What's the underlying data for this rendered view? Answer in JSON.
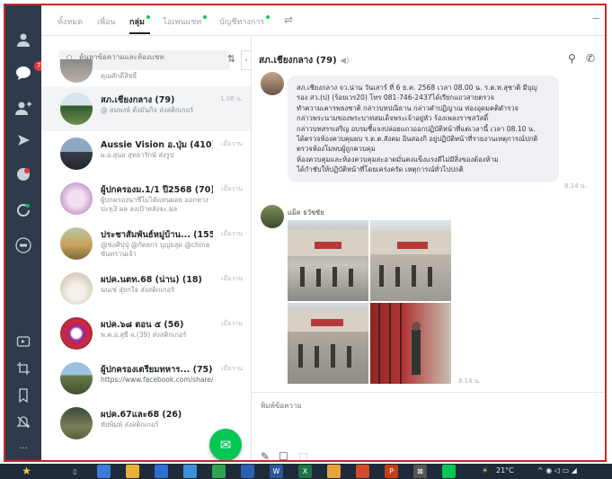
{
  "tabs": {
    "all": "ทั้งหมด",
    "friends": "เพื่อน",
    "groups": "กลุ่ม",
    "openchat": "โอเพนแชท",
    "official": "บัญชีทางการ",
    "filter_icon": "filter-icon"
  },
  "sidebar": {
    "chat_badge": "73"
  },
  "search": {
    "placeholder": "ค้นหาข้อความและห้องแชท"
  },
  "chats": [
    {
      "name": "",
      "preview": "คุณศักดิ์สิทธิ์",
      "time": ""
    },
    {
      "name": "สภ.เชียงกลาง (79)",
      "preview": "@ สมพงษ์ ตั้งมั่นกิจ ส่งสติกเกอร์",
      "time": "1.06 น."
    },
    {
      "name": "Aussie Vision อ.ปุ่ม (410)",
      "preview": "ผ.อ.สุนย สุทธารักษ์ ส่งรูป",
      "time": "เมื่อวาน"
    },
    {
      "name": "ผู้ปกครองม.1/1 ปี2568 (70)",
      "preview": "ผู้ปกครองนาซีไม่ได้แทนผลย ออกทางปะทุ3 ผล ลงเป้าหลังจะ.ผล",
      "time": "เมื่อวาน"
    },
    {
      "name": "ประชาสัมพันธ์หมู่บ้าน...",
      "count": "(155)",
      "preview": "@ช่อศิปุ่ปุ่ @กัดยกร บุญยสุด @china ขันทรานเจ้า",
      "time": "เมื่อวาน"
    },
    {
      "name": "ผปค.นตท.68 (น่าน) (18)",
      "preview": "นนเช่ สุ่ยกใจ ส่งสติกเกอร์",
      "time": "เมื่อวาน"
    },
    {
      "name": "ผปค.๖๘ ตอน ๕ (56)",
      "preview": "พ.ต.อ.สุธี จ.(39) ส่งสติกเกอร์",
      "time": "เมื่อวาน"
    },
    {
      "name": "ผู้ปกครองเตรียมทหาร...",
      "count": "(75)",
      "preview": "https://www.facebook.com/share/r/1HJNd8a7VW/",
      "time": "เมื่อวาน"
    },
    {
      "name": "ผปค.67และ68 (26)",
      "preview": "หัยพิมพ์ ส่งสติกเกอร์",
      "time": ""
    }
  ],
  "conversation": {
    "title": "สภ.เชียงกลาง (79)",
    "message_lines": [
      "สภ.เชียงกลาง จว.น่าน วันเสาร์ ที่ 6 ธ.ค. 2568 เวลา 08.00 น. ร.ต.ท.สุชาติ มีบุญ",
      "รอง สว.(ป) (ร้อยเวร20) โทร  081-746-2437ได้เรียกแถวสายตรวจ",
      "ทำความเคารพธงชาติ กล่าวบทปณิธาน กล่าวคำปฏิญาณ ห่องอุดมคติตำรวจ",
      "กล่าวพระนามของพระบาทสมเด็จพระเจ้าอยู่หัว ร้องเพลงราชสวัสดิ์",
      "กล่าวบทสรรเสริญ อบรมชี้แจงปล่อยแถวออกปฏิบัติหน้าที่แต่เวลานี้ เวลา 08.10 น.",
      "ได้ตรวจห้องควบคุมผบ ร.ต.ต.สังคม อินสองกิ อยู่ปฏิบัติหน้าที่รายงานเหตุการณ์ปกติ",
      "ตรวจห้องโมพบผู้ถูกควบคุม",
      "ห้องควบคุมและห้องควบคุมสะอาดมั่นคงแข็งแรงดีไม่มีสิ่งของต้องห้าม",
      "ได้กำชับให้ปฏิบัติหน้าที่โดยเคร่งครัด เหตุการณ์ทั่วไปปกติ"
    ],
    "message_time": "8.14 น.",
    "sender": "แม็ค ธวัชชัย",
    "photos_time": "8.14 น.",
    "compose_placeholder": "พิมพ์ข้อความ"
  },
  "taskbar": {
    "temperature": "21°C"
  },
  "colors": {
    "rail": "#2f3a4c",
    "accent": "#06c755",
    "badge": "#e8383d",
    "border": "#c8262b",
    "taskbar": "#1f2a3a"
  }
}
